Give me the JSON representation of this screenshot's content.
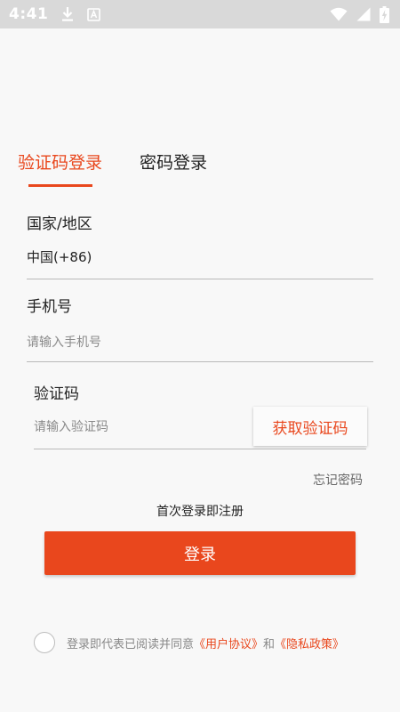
{
  "status_bar": {
    "time": "4:41",
    "icons": [
      "download-icon",
      "text-box-icon",
      "wifi-icon",
      "signal-icon",
      "battery-charging-icon"
    ]
  },
  "tabs": [
    {
      "label": "验证码登录",
      "active": true
    },
    {
      "label": "密码登录",
      "active": false
    }
  ],
  "form": {
    "country_label": "国家/地区",
    "country_value": "中国(+86)",
    "phone_label": "手机号",
    "phone_placeholder": "请输入手机号",
    "code_label": "验证码",
    "code_placeholder": "请输入验证码",
    "get_code_label": "获取验证码"
  },
  "forgot_password": "忘记密码",
  "first_login_note": "首次登录即注册",
  "login_button": "登录",
  "agreement": {
    "prefix": "登录即代表已阅读并同意",
    "user_agreement": "《用户协议》",
    "conjunction": "和",
    "privacy_policy": "《隐私政策》"
  },
  "colors": {
    "accent": "#e9471d",
    "status_bar": "#d9d9d9",
    "background": "#f8f8f8"
  }
}
